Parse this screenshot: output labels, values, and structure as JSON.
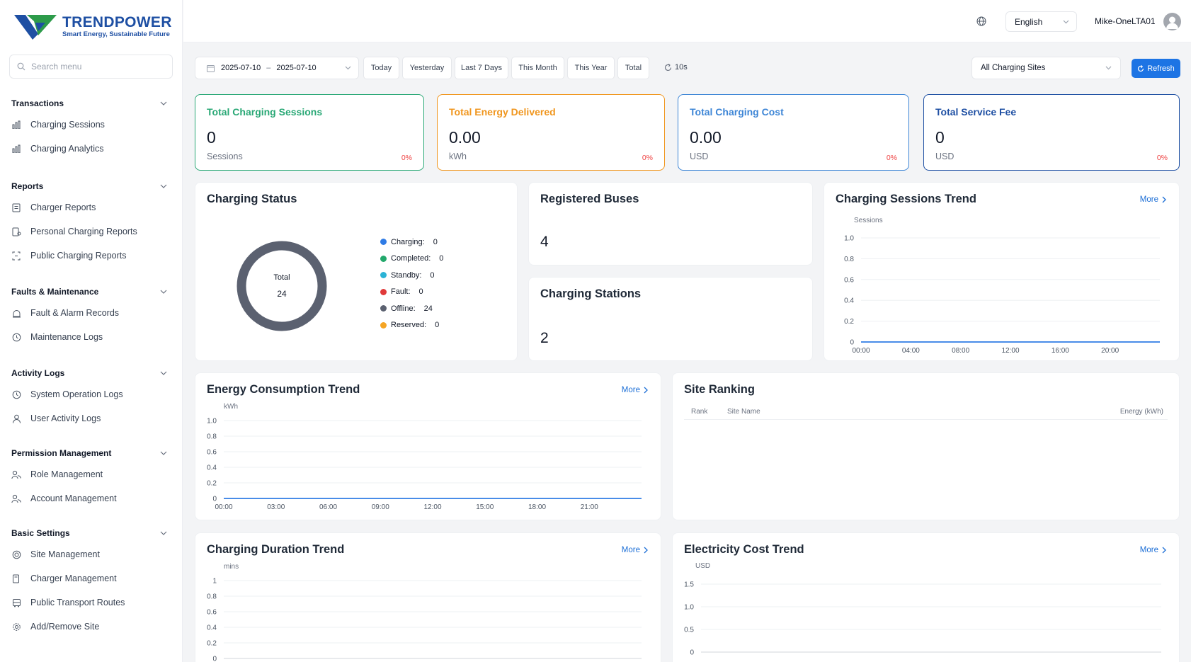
{
  "brand": {
    "name": "TRENDPOWER",
    "tagline": "Smart Energy, Sustainable Future"
  },
  "search": {
    "placeholder": "Search menu"
  },
  "sidebar": {
    "groups": [
      {
        "label": "Transactions",
        "items": [
          {
            "label": "Charging Sessions",
            "icon": "bar-chart-icon"
          },
          {
            "label": "Charging Analytics",
            "icon": "bar-chart-icon"
          }
        ]
      },
      {
        "label": "Reports",
        "items": [
          {
            "label": "Charger Reports",
            "icon": "report-icon"
          },
          {
            "label": "Personal Charging Reports",
            "icon": "user-report-icon"
          },
          {
            "label": "Public Charging Reports",
            "icon": "public-report-icon"
          }
        ]
      },
      {
        "label": "Faults & Maintenance",
        "items": [
          {
            "label": "Fault & Alarm Records",
            "icon": "alarm-icon"
          },
          {
            "label": "Maintenance Logs",
            "icon": "clock-icon"
          }
        ]
      },
      {
        "label": "Activity Logs",
        "items": [
          {
            "label": "System Operation Logs",
            "icon": "clock-icon"
          },
          {
            "label": "User Activity Logs",
            "icon": "user-icon"
          }
        ]
      },
      {
        "label": "Permission Management",
        "items": [
          {
            "label": "Role Management",
            "icon": "users-icon"
          },
          {
            "label": "Account Management",
            "icon": "users-icon"
          }
        ]
      },
      {
        "label": "Basic Settings",
        "items": [
          {
            "label": "Site Management",
            "icon": "target-icon"
          },
          {
            "label": "Charger Management",
            "icon": "charger-icon"
          },
          {
            "label": "Public Transport Routes",
            "icon": "bus-icon"
          },
          {
            "label": "Add/Remove Site",
            "icon": "gear-icon"
          }
        ]
      }
    ]
  },
  "header": {
    "language": "English",
    "username": "Mike-OneLTA01"
  },
  "filters": {
    "start_date": "2025-07-10",
    "separator": "–",
    "end_date": "2025-07-10",
    "quick": [
      "Today",
      "Yesterday",
      "Last 7 Days",
      "This Month",
      "This Year",
      "Total"
    ],
    "interval": "10s",
    "site": "All Charging Sites",
    "refresh": "Refresh"
  },
  "kpis": [
    {
      "title": "Total Charging Sessions",
      "value": "0",
      "unit": "Sessions",
      "change": "0%",
      "color": "#2aa876"
    },
    {
      "title": "Total Energy Delivered",
      "value": "0.00",
      "unit": "kWh",
      "change": "0%",
      "color": "#f0961e"
    },
    {
      "title": "Total Charging Cost",
      "value": "0.00",
      "unit": "USD",
      "change": "0%",
      "color": "#3e86d6"
    },
    {
      "title": "Total Service Fee",
      "value": "0",
      "unit": "USD",
      "change": "0%",
      "color": "#1e4fa3"
    }
  ],
  "charging_status": {
    "title": "Charging Status",
    "total_label": "Total",
    "total": "24",
    "legend": [
      {
        "label": "Charging:",
        "value": "0",
        "color": "#2f7be5"
      },
      {
        "label": "Completed:",
        "value": "0",
        "color": "#22a86b"
      },
      {
        "label": "Standby:",
        "value": "0",
        "color": "#2bb3d6"
      },
      {
        "label": "Fault:",
        "value": "0",
        "color": "#e03a3a"
      },
      {
        "label": "Offline:",
        "value": "24",
        "color": "#5b6170"
      },
      {
        "label": "Reserved:",
        "value": "0",
        "color": "#f5a524"
      }
    ]
  },
  "registered_buses": {
    "title": "Registered Buses",
    "value": "4"
  },
  "charging_stations": {
    "title": "Charging Stations",
    "value": "2"
  },
  "more_label": "More",
  "site_ranking": {
    "title": "Site Ranking",
    "columns": [
      "Rank",
      "Site Name",
      "Energy (kWh)"
    ]
  },
  "chart_data": [
    {
      "type": "line",
      "title": "Charging Sessions Trend",
      "ylabel": "Sessions",
      "x": [
        "00:00",
        "04:00",
        "08:00",
        "12:00",
        "16:00",
        "20:00"
      ],
      "yticks": [
        "1.0",
        "0.8",
        "0.6",
        "0.4",
        "0.2",
        "0"
      ],
      "ylim": [
        0,
        1
      ],
      "series": [
        {
          "values": [
            0,
            0,
            0,
            0,
            0,
            0
          ]
        }
      ]
    },
    {
      "type": "line",
      "title": "Energy Consumption Trend",
      "ylabel": "kWh",
      "x": [
        "00:00",
        "03:00",
        "06:00",
        "09:00",
        "12:00",
        "15:00",
        "18:00",
        "21:00"
      ],
      "yticks": [
        "1.0",
        "0.8",
        "0.6",
        "0.4",
        "0.2",
        "0"
      ],
      "ylim": [
        0,
        1
      ],
      "series": [
        {
          "values": [
            0,
            0,
            0,
            0,
            0,
            0,
            0,
            0
          ]
        }
      ]
    },
    {
      "type": "line",
      "title": "Charging Duration Trend",
      "ylabel": "mins",
      "x": [],
      "yticks": [
        "1",
        "0.8",
        "0.6",
        "0.4",
        "0.2",
        "0"
      ],
      "ylim": [
        0,
        1
      ],
      "series": []
    },
    {
      "type": "line",
      "title": "Electricity Cost Trend",
      "ylabel": "USD",
      "x": [],
      "yticks": [
        "1.5",
        "1.0",
        "0.5",
        "0"
      ],
      "ylim": [
        0,
        1.5
      ],
      "series": []
    }
  ]
}
